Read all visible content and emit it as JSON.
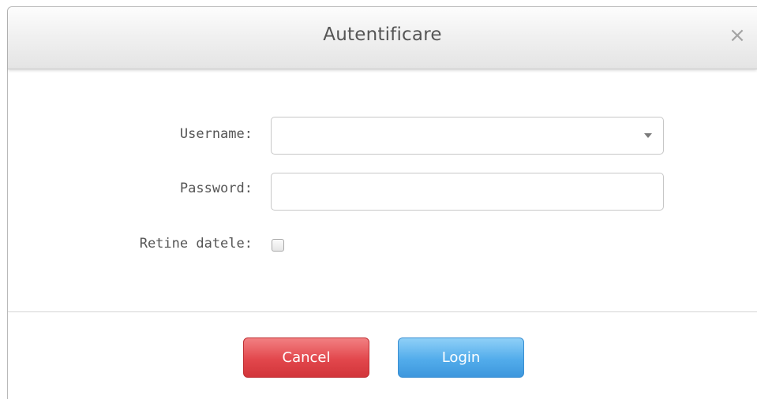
{
  "dialog": {
    "title": "Autentificare",
    "close_glyph": "×"
  },
  "form": {
    "username_label": "Username:",
    "username_value": "",
    "password_label": "Password:",
    "password_value": "",
    "remember_label": "Retine datele:",
    "remember_checked": false
  },
  "buttons": {
    "cancel_label": "Cancel",
    "login_label": "Login"
  },
  "colors": {
    "cancel": "#e2474c",
    "login": "#52aceb",
    "title_text": "#555555"
  },
  "icons": {
    "close": "close-icon",
    "dropdown": "chevron-down-icon"
  }
}
